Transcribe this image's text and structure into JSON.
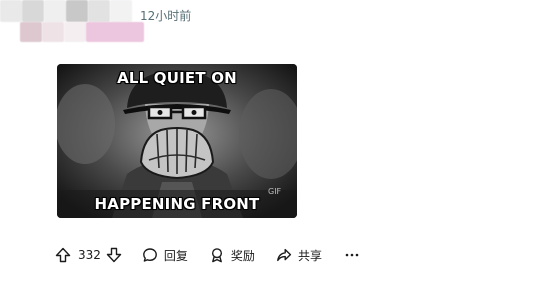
{
  "post": {
    "timestamp": "12小时前",
    "media": {
      "caption_top": "ALL QUIET ON",
      "caption_bottom": "HAPPENING FRONT",
      "badge": "GIF"
    }
  },
  "actions": {
    "vote_count": "332",
    "reply_label": "回复",
    "award_label": "奖励",
    "share_label": "共享",
    "more_label": "..."
  },
  "icons": {
    "upvote": "upvote-arrow-icon",
    "downvote": "downvote-arrow-icon",
    "reply": "speech-bubble-icon",
    "award": "award-icon",
    "share": "share-arrow-icon",
    "more": "more-dots-icon"
  }
}
